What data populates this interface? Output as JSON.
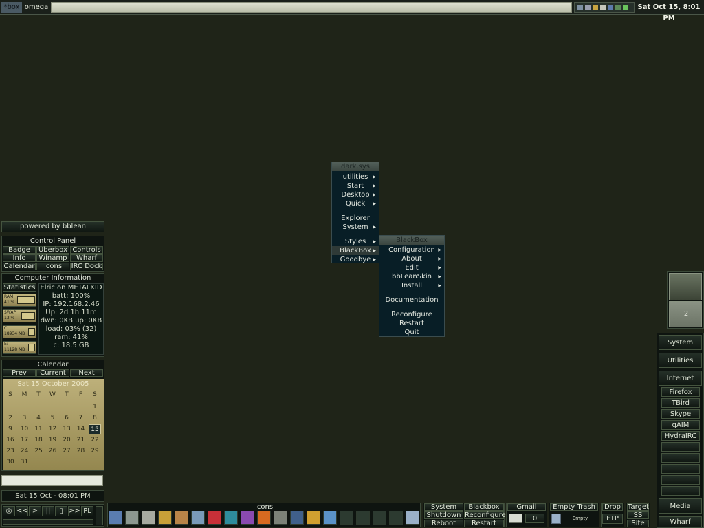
{
  "taskbar": {
    "start_label": "*box",
    "workspace": "omega",
    "clock": "Sat Oct 15, 8:01 PM"
  },
  "menu_main": {
    "title": "dark.sys",
    "items": [
      "utilities",
      "Start",
      "Desktop",
      "Quick",
      "Explorer",
      "System",
      "Styles",
      "BlackBox",
      "Goodbye"
    ]
  },
  "menu_sub": {
    "title": "BlackBox",
    "items": [
      "Configuration",
      "About",
      "Edit",
      "bbLeanSkin",
      "Install",
      "Documentation",
      "Reconfigure",
      "Restart",
      "Quit"
    ]
  },
  "left": {
    "powered": "powered by bblean",
    "control_panel": {
      "title": "Control Panel",
      "buttons": [
        "Badge",
        "Uberbox",
        "Controls",
        "Info",
        "Winamp",
        "Wharf",
        "Calendar",
        "Icons",
        "IRC Dock"
      ]
    },
    "computer_info": {
      "title": "Computer Information",
      "statistics_label": "Statistics",
      "meters": [
        {
          "label": "RAM",
          "value": "41 %"
        },
        {
          "label": "SWAP",
          "value": "13 %"
        },
        {
          "label": "C:",
          "value": "18934 MB"
        },
        {
          "label": "E:",
          "value": "11128 MB"
        }
      ],
      "lines": [
        "Elric on METALKID",
        "batt: 100%",
        "IP: 192.168.2.46",
        "Up: 2d 1h 11m",
        "dwn: 0KB up: 0KB",
        "load: 03% (32)",
        "ram: 41%",
        "c: 18.5 GB"
      ]
    },
    "calendar": {
      "title": "Calendar",
      "nav": [
        "Prev",
        "Current",
        "Next"
      ],
      "header": "Sat 15 October  2005",
      "weekdays": [
        "S",
        "M",
        "T",
        "W",
        "T",
        "F",
        "S"
      ],
      "days": [
        "",
        "",
        "",
        "",
        "",
        "",
        "1",
        "2",
        "3",
        "4",
        "5",
        "6",
        "7",
        "8",
        "9",
        "10",
        "11",
        "12",
        "13",
        "14",
        "15",
        "16",
        "17",
        "18",
        "19",
        "20",
        "21",
        "22",
        "23",
        "24",
        "25",
        "26",
        "27",
        "28",
        "29",
        "30",
        "31",
        "",
        "",
        "",
        "",
        ""
      ],
      "selected": "15"
    },
    "date_line": "Sat 15 Oct - 08:01 PM",
    "media_buttons": [
      "◎",
      "<<",
      ">",
      "||",
      "▯",
      ">>",
      "PL"
    ]
  },
  "icons_bar": {
    "title": "Icons"
  },
  "bottom_right": {
    "col1": [
      "System",
      "Shutdown",
      "Reboot"
    ],
    "col2": [
      "Blackbox",
      "Reconfigure",
      "Restart"
    ],
    "gmail": "Gmail",
    "gmail_count": "0",
    "trash": "Empty Trash",
    "trash_status": "Empty",
    "drop": "Drop",
    "ftp": "FTP",
    "col5": [
      "Target",
      "SS",
      "Site"
    ]
  },
  "right": {
    "workspace_num": "2",
    "buttons": [
      "System",
      "Utilities",
      "Internet"
    ],
    "internet_items": [
      "Firefox",
      "TBird",
      "Skype",
      "gAIM",
      "HydraIRC",
      "",
      "",
      "",
      "",
      ""
    ],
    "media": "Media",
    "wharf": "Wharf"
  },
  "colors": {
    "desktop": "#1f2418",
    "menu_bg": "#081e26",
    "calendar_gold": "#a89c66"
  }
}
